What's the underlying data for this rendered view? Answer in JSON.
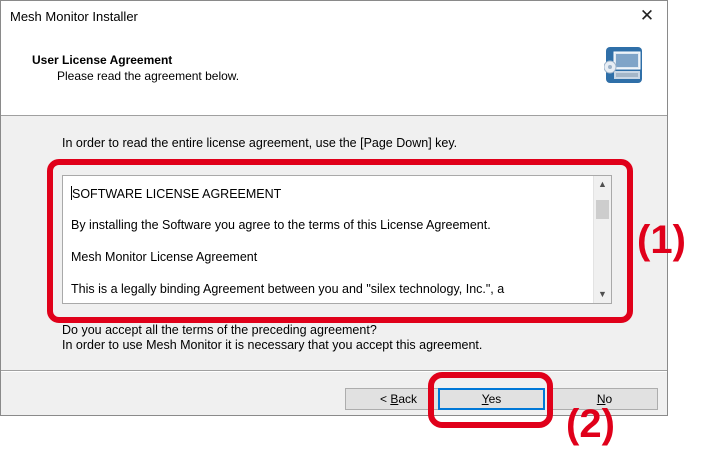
{
  "window": {
    "title": "Mesh Monitor Installer",
    "close_glyph": "✕"
  },
  "header": {
    "title": "User License Agreement",
    "subtitle": "Please read the agreement below.",
    "icon": "computer-install-icon"
  },
  "instructions": "In order to read the entire license agreement, use the [Page Down] key.",
  "license_text": {
    "lines": [
      "SOFTWARE LICENSE AGREEMENT",
      "By installing the Software you agree to the terms of this License Agreement.",
      "Mesh Monitor License Agreement",
      "This is a legally binding Agreement between you and \"silex technology, Inc.\", a"
    ]
  },
  "accept": {
    "question": "Do you accept all the terms of the preceding agreement?",
    "note": "In order to use Mesh Monitor it is necessary that you accept this agreement."
  },
  "buttons": {
    "back": {
      "prefix": "< ",
      "mnemonic": "B",
      "rest": "ack"
    },
    "yes": {
      "mnemonic": "Y",
      "rest": "es"
    },
    "no": {
      "mnemonic": "N",
      "rest": "o"
    }
  },
  "annotations": {
    "one": "(1)",
    "two": "(2)"
  },
  "colors": {
    "highlight": "#e0001a",
    "default_button_border": "#0078d7"
  }
}
